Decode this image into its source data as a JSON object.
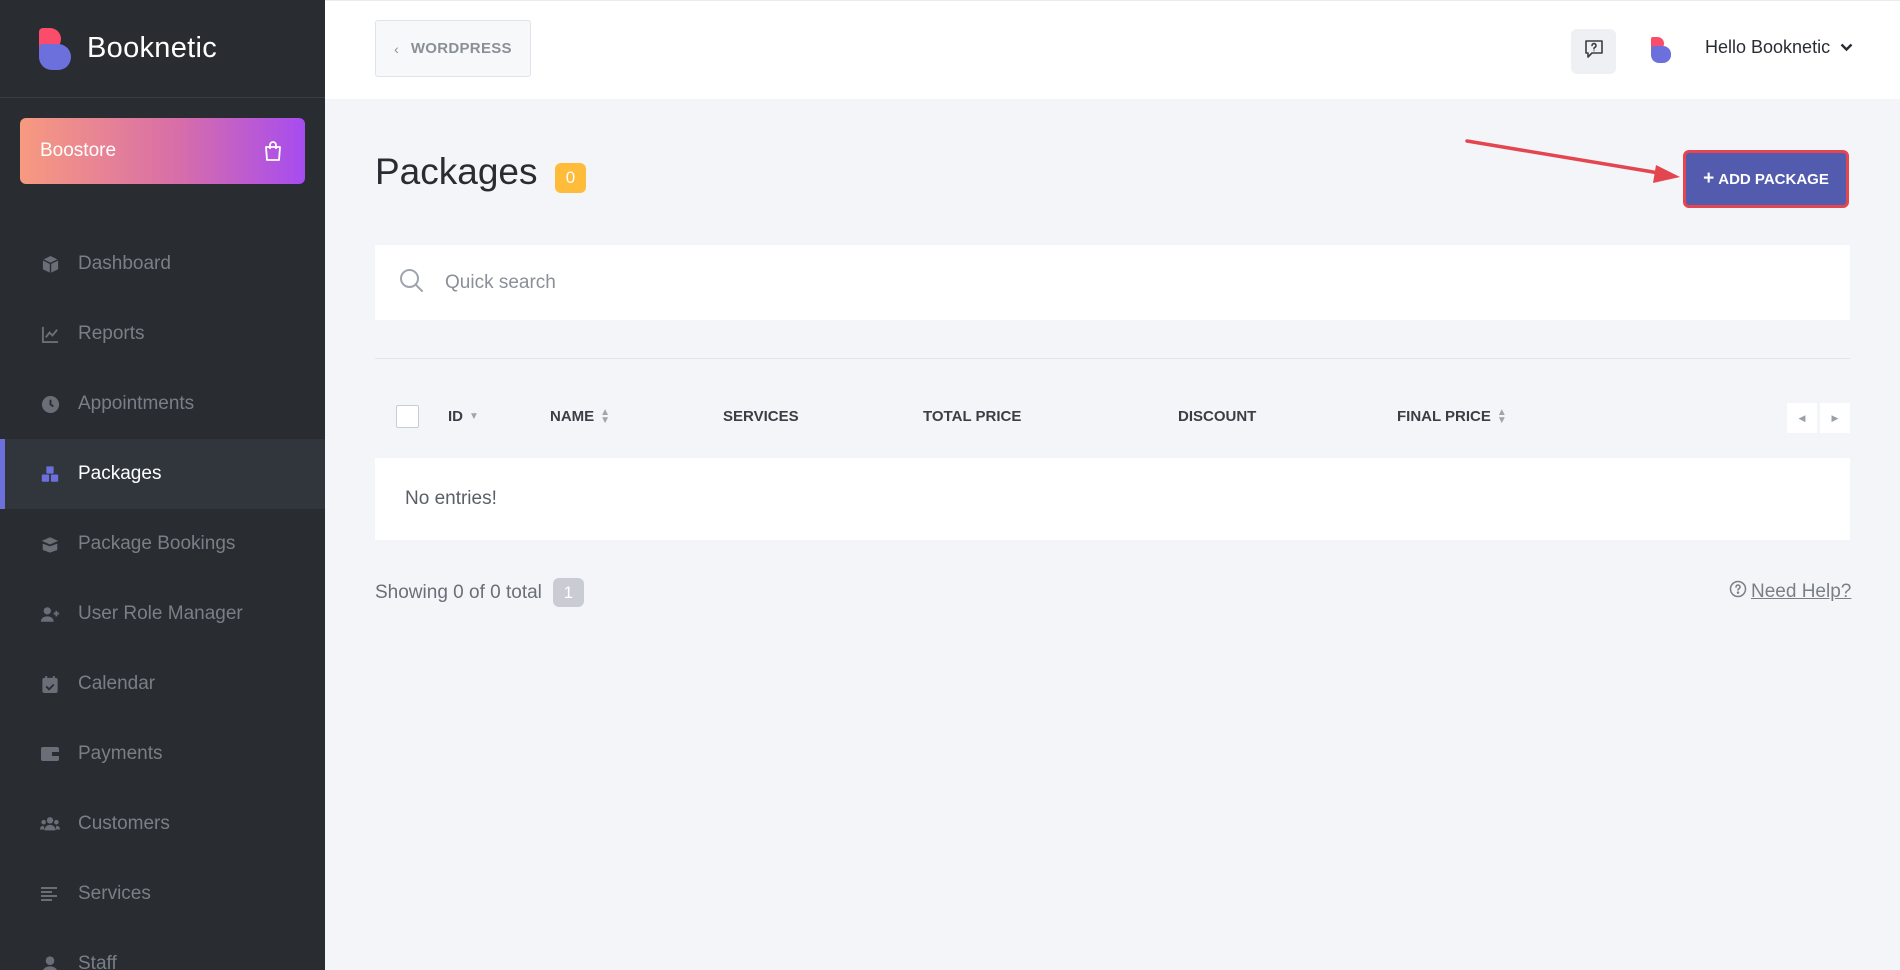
{
  "brand": {
    "name": "Booknetic"
  },
  "boostore": {
    "label": "Boostore"
  },
  "sidebar": {
    "items": [
      {
        "label": "Dashboard",
        "icon": "cube-icon",
        "active": false
      },
      {
        "label": "Reports",
        "icon": "chart-line-icon",
        "active": false
      },
      {
        "label": "Appointments",
        "icon": "clock-icon",
        "active": false
      },
      {
        "label": "Packages",
        "icon": "cubes-icon",
        "active": true
      },
      {
        "label": "Package Bookings",
        "icon": "box-open-icon",
        "active": false
      },
      {
        "label": "User Role Manager",
        "icon": "user-plus-icon",
        "active": false
      },
      {
        "label": "Calendar",
        "icon": "calendar-check-icon",
        "active": false
      },
      {
        "label": "Payments",
        "icon": "wallet-icon",
        "active": false
      },
      {
        "label": "Customers",
        "icon": "users-icon",
        "active": false
      },
      {
        "label": "Services",
        "icon": "list-icon",
        "active": false
      },
      {
        "label": "Staff",
        "icon": "user-icon",
        "active": false
      }
    ]
  },
  "topbar": {
    "back_label": "WORDPRESS",
    "user_greeting": "Hello Booknetic"
  },
  "page": {
    "title": "Packages",
    "count": "0",
    "add_button": "ADD PACKAGE"
  },
  "search": {
    "placeholder": "Quick search"
  },
  "table": {
    "columns": [
      "ID",
      "NAME",
      "SERVICES",
      "TOTAL PRICE",
      "DISCOUNT",
      "FINAL PRICE"
    ],
    "empty_text": "No entries!"
  },
  "footer": {
    "showing": "Showing 0 of 0 total",
    "page": "1",
    "help": "Need Help?"
  },
  "colors": {
    "accent": "#6c70dc",
    "add_button": "#525bad",
    "highlight": "#e44650",
    "badge": "#ffbc3a"
  }
}
